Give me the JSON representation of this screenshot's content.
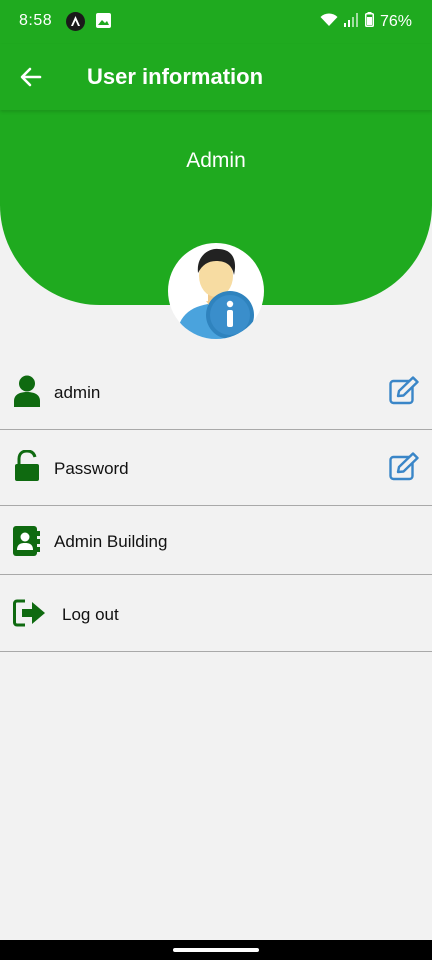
{
  "status_bar": {
    "time": "8:58",
    "battery": "76%"
  },
  "app_bar": {
    "title": "User information"
  },
  "header": {
    "name": "Admin"
  },
  "rows": [
    {
      "label": "admin",
      "icon": "person-icon",
      "editable": true
    },
    {
      "label": "Password",
      "icon": "unlock-icon",
      "editable": true
    },
    {
      "label": "Admin Building",
      "icon": "contact-book-icon",
      "editable": false
    },
    {
      "label": "Log out",
      "icon": "logout-icon",
      "editable": false
    }
  ],
  "colors": {
    "primary": "#1faa1f",
    "icon_green": "#0f6a10",
    "edit_blue": "#3a86c8",
    "background": "#f2f2f2"
  }
}
